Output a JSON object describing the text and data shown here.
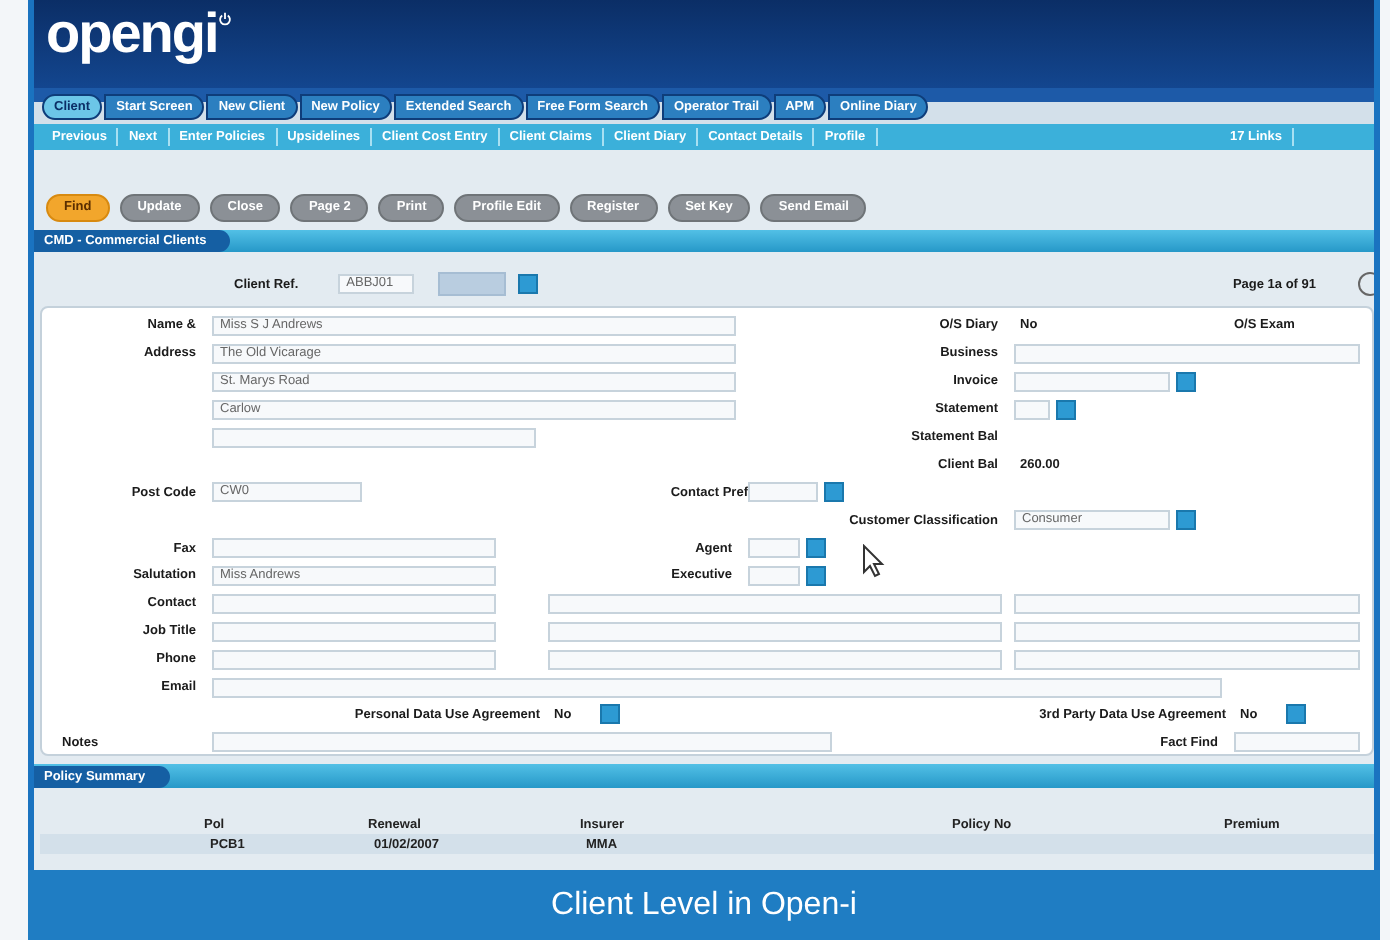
{
  "logo": {
    "text": "opengi"
  },
  "nav_tabs": [
    {
      "label": "Client",
      "selected": true
    },
    {
      "label": "Start Screen",
      "selected": false
    },
    {
      "label": "New Client",
      "selected": false
    },
    {
      "label": "New Policy",
      "selected": false
    },
    {
      "label": "Extended Search",
      "selected": false
    },
    {
      "label": "Free Form Search",
      "selected": false
    },
    {
      "label": "Operator Trail",
      "selected": false
    },
    {
      "label": "APM",
      "selected": false
    },
    {
      "label": "Online Diary",
      "selected": false
    }
  ],
  "sub_tabs": [
    "Previous",
    "Next",
    "Enter Policies",
    "Upsidelines",
    "Client Cost Entry",
    "Client Claims",
    "Client Diary",
    "Contact Details",
    "Profile"
  ],
  "links": "17 Links",
  "actions": [
    {
      "label": "Find",
      "kind": "primary"
    },
    {
      "label": "Update",
      "kind": "normal"
    },
    {
      "label": "Close",
      "kind": "normal"
    },
    {
      "label": "Page 2",
      "kind": "normal"
    },
    {
      "label": "Print",
      "kind": "normal"
    },
    {
      "label": "Profile Edit",
      "kind": "normal"
    },
    {
      "label": "Register",
      "kind": "normal"
    },
    {
      "label": "Set Key",
      "kind": "normal"
    },
    {
      "label": "Send Email",
      "kind": "normal"
    }
  ],
  "section_title": "CMD - Commercial Clients",
  "client_ref": {
    "label": "Client Ref.",
    "value": "ABBJ01"
  },
  "page_info": "Page 1a of 91",
  "form": {
    "name": {
      "label": "Name &",
      "value": "Miss S J Andrews"
    },
    "address": {
      "label": "Address",
      "lines": [
        "The Old Vicarage",
        "St. Marys Road",
        "Carlow"
      ]
    },
    "post_code": {
      "label": "Post Code",
      "value": "CW0"
    },
    "contact_pref": {
      "label": "Contact Pref"
    },
    "fax": {
      "label": "Fax"
    },
    "salutation": {
      "label": "Salutation",
      "value": "Miss Andrews"
    },
    "contact": {
      "label": "Contact"
    },
    "job_title": {
      "label": "Job Title"
    },
    "phone": {
      "label": "Phone"
    },
    "email": {
      "label": "Email"
    },
    "personal_data": {
      "label": "Personal Data Use Agreement",
      "value": "No"
    },
    "notes": {
      "label": "Notes"
    },
    "os_diary": {
      "label": "O/S Diary",
      "value": "No"
    },
    "os_exam": {
      "label": "O/S Exam"
    },
    "business": {
      "label": "Business"
    },
    "invoice": {
      "label": "Invoice"
    },
    "statement": {
      "label": "Statement"
    },
    "statement_bal": {
      "label": "Statement Bal"
    },
    "client_bal": {
      "label": "Client Bal",
      "value": "260.00"
    },
    "classification": {
      "label": "Customer Classification",
      "value": "Consumer"
    },
    "agent": {
      "label": "Agent"
    },
    "executive": {
      "label": "Executive"
    },
    "third_party": {
      "label": "3rd Party Data Use Agreement",
      "value": "No"
    },
    "fact_find": {
      "label": "Fact Find"
    }
  },
  "policy_summary": {
    "title": "Policy Summary",
    "columns": [
      "Pol",
      "Renewal",
      "Insurer",
      "Policy No",
      "Premium"
    ],
    "rows": [
      {
        "cells": [
          "PCB1",
          "01/02/2007",
          "MMA"
        ],
        "selected": true
      }
    ]
  },
  "caption": "Client Level in Open-i"
}
